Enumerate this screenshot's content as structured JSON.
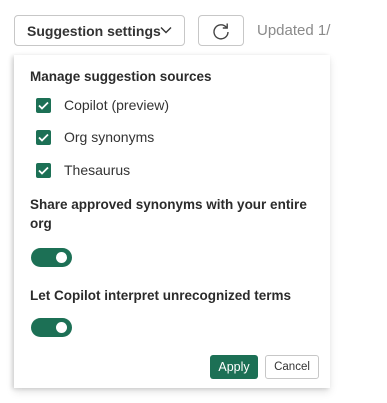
{
  "toolbar": {
    "settings_label": "Suggestion settings",
    "updated_text": "Updated 1/"
  },
  "panel": {
    "sources_heading": "Manage suggestion sources",
    "sources": [
      {
        "label": "Copilot (preview)",
        "checked": true
      },
      {
        "label": "Org synonyms",
        "checked": true
      },
      {
        "label": "Thesaurus",
        "checked": true
      }
    ],
    "share_heading": "Share approved synonyms with your entire org",
    "share_enabled": true,
    "copilot_heading": "Let Copilot interpret unrecognized terms",
    "copilot_enabled": true,
    "apply_label": "Apply",
    "cancel_label": "Cancel"
  },
  "colors": {
    "accent": "#1c7055",
    "border": "#c7c7c7",
    "muted_text": "#8a8a8a"
  },
  "icons": [
    "chevron-down-icon",
    "refresh-icon",
    "checkmark-icon"
  ]
}
